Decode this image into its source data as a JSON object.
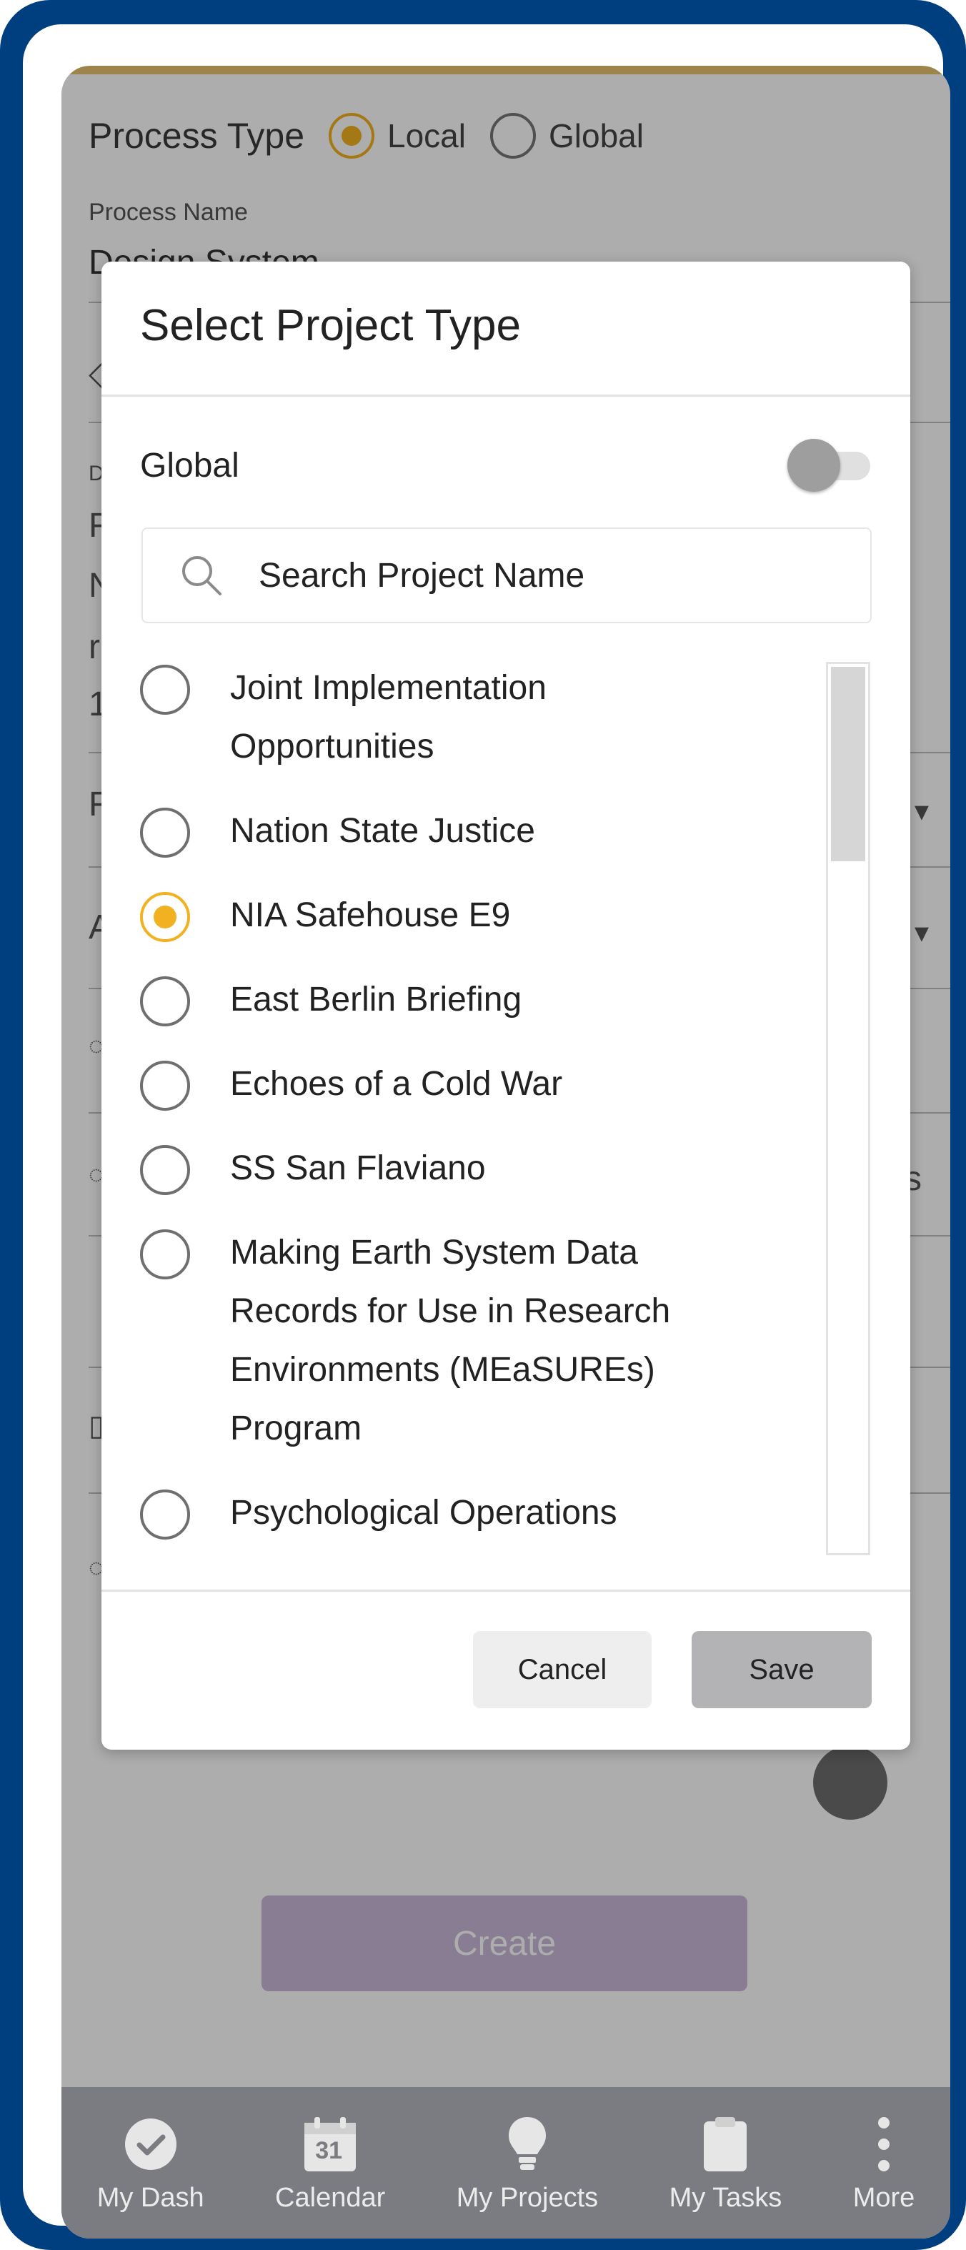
{
  "background_form": {
    "process_type_label": "Process Type",
    "process_type_options": [
      {
        "label": "Local",
        "selected": true
      },
      {
        "label": "Global",
        "selected": false
      }
    ],
    "process_name_label": "Process Name",
    "process_name_value": "Design System",
    "partial_row_glyphs": [
      "D",
      "F",
      "N",
      "r",
      "1",
      "F",
      "A",
      "s"
    ],
    "create_button_label": "Create"
  },
  "modal": {
    "title": "Select Project Type",
    "global_toggle_label": "Global",
    "global_toggle_on": false,
    "search_placeholder": "Search Project Name",
    "items": [
      {
        "label": "Joint Implementation Opportunities",
        "selected": false
      },
      {
        "label": "Nation State Justice",
        "selected": false
      },
      {
        "label": "NIA Safehouse E9",
        "selected": true
      },
      {
        "label": "East Berlin Briefing",
        "selected": false
      },
      {
        "label": "Echoes of a Cold War",
        "selected": false
      },
      {
        "label": "SS San Flaviano",
        "selected": false
      },
      {
        "label": "Making Earth System Data Records for Use in Research Environments (MEaSUREs) Program",
        "selected": false
      },
      {
        "label": "Psychological Operations",
        "selected": false
      }
    ],
    "cancel_label": "Cancel",
    "save_label": "Save"
  },
  "bottom_nav": [
    {
      "label": "My Dash",
      "icon": "check-circle-icon"
    },
    {
      "label": "Calendar",
      "icon": "calendar-icon",
      "icon_text": "31"
    },
    {
      "label": "My Projects",
      "icon": "lightbulb-icon"
    },
    {
      "label": "My Tasks",
      "icon": "clipboard-icon"
    },
    {
      "label": "More",
      "icon": "more-vertical-icon"
    }
  ],
  "colors": {
    "frame": "#003f7f",
    "accent": "#f2b120",
    "nav_background": "#7a7c82",
    "create_button": "#c9b9d9"
  }
}
